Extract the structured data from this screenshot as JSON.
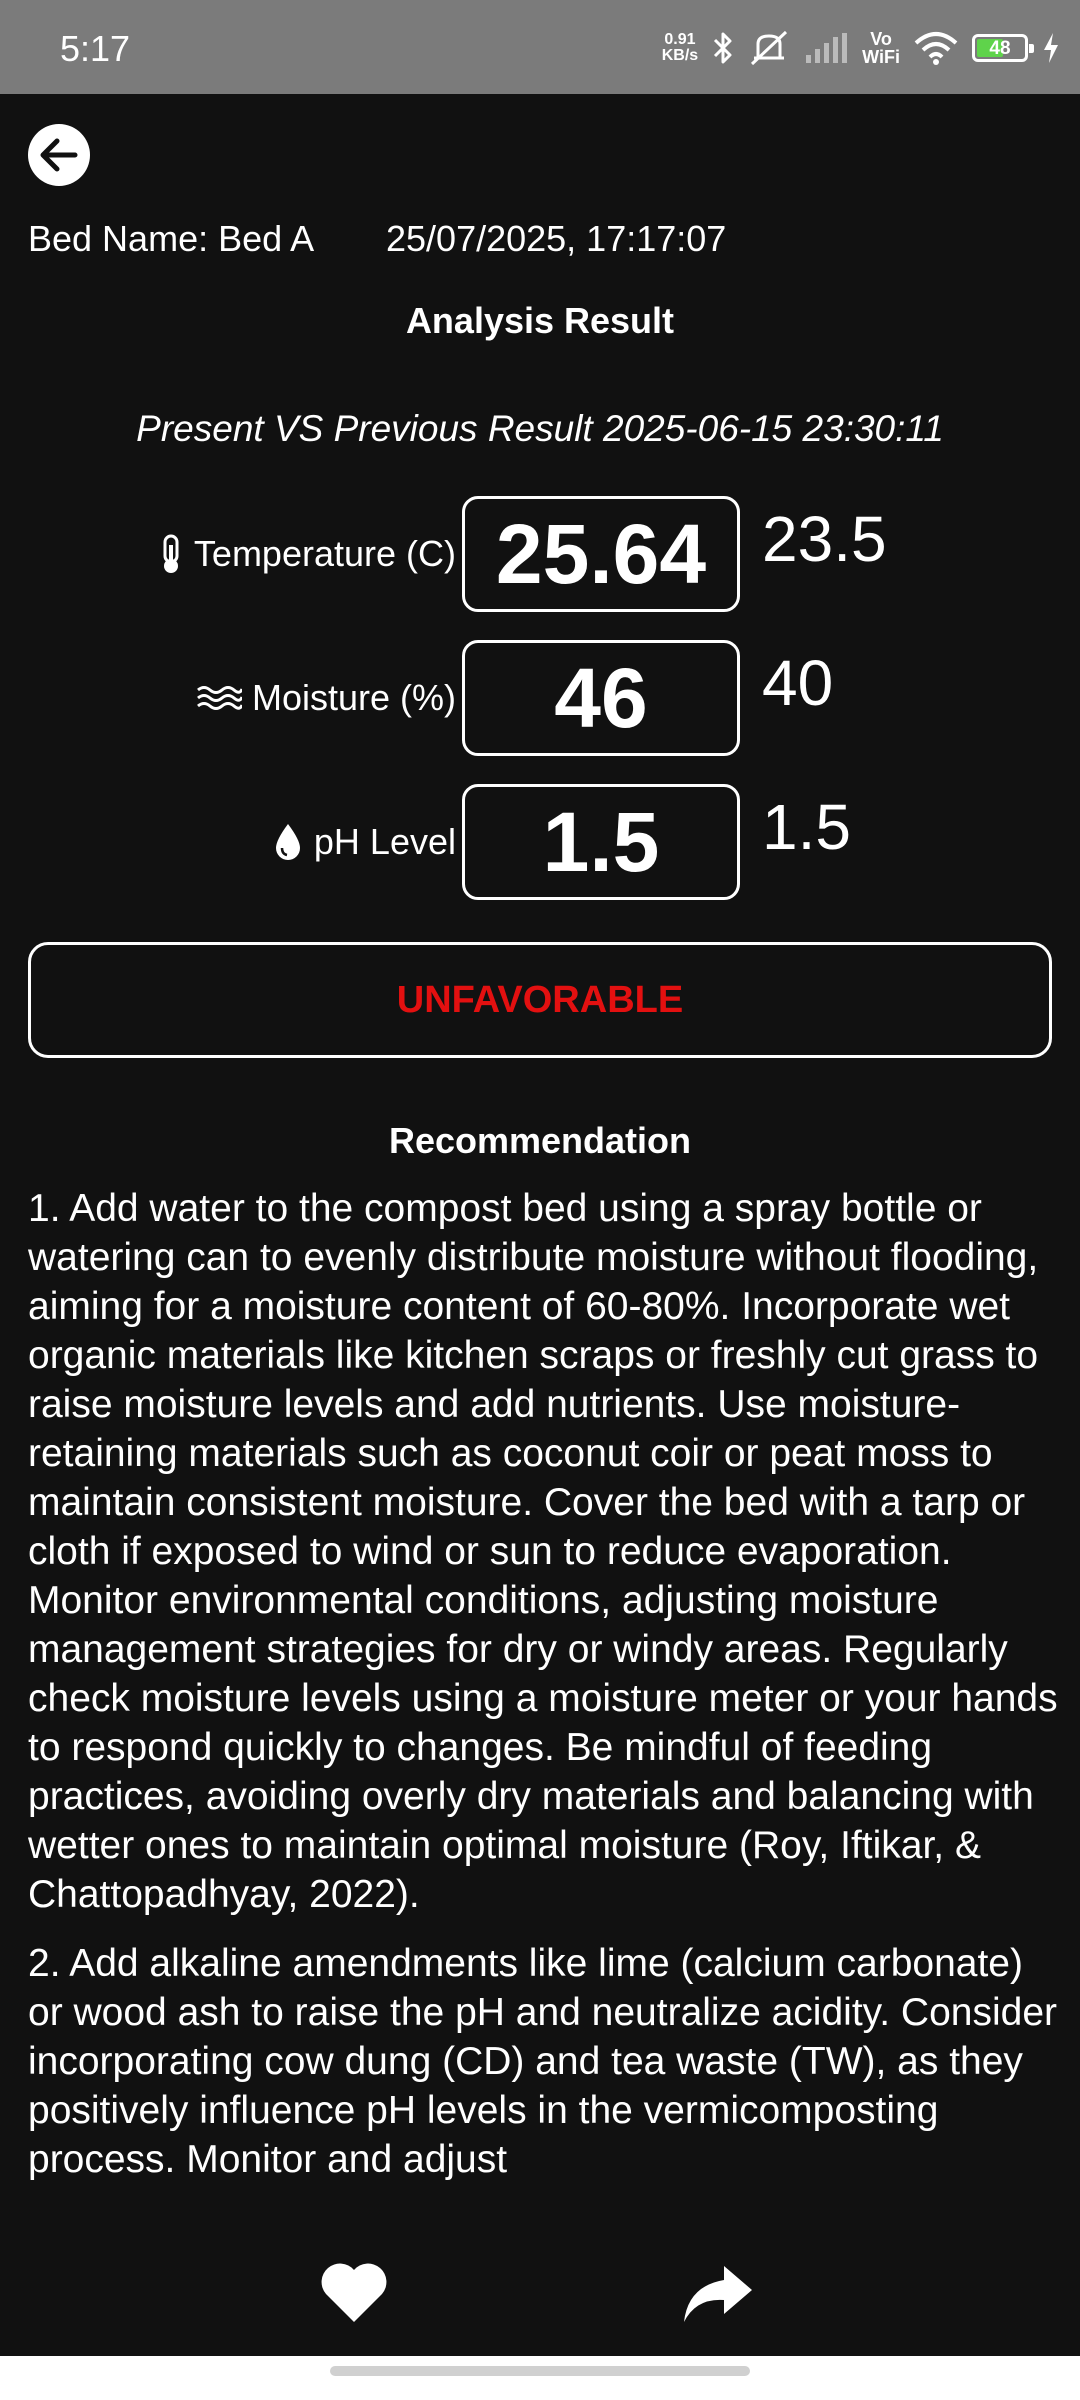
{
  "status_bar": {
    "time": "5:17",
    "net_speed_value": "0.91",
    "net_speed_unit": "KB/s",
    "vowifi_top": "Vo",
    "vowifi_bottom": "WiFi",
    "battery": "48",
    "icons": [
      "bluetooth-icon",
      "mute-icon",
      "signal-icon",
      "wifi-icon",
      "battery-icon",
      "charging-icon"
    ]
  },
  "header": {
    "bed_name": "Bed Name: Bed A",
    "datetime": "25/07/2025, 17:17:07",
    "title": "Analysis Result",
    "comparison": "Present VS Previous Result 2025-06-15 23:30:11"
  },
  "metrics": [
    {
      "icon": "thermometer-icon",
      "label": "Temperature (C)",
      "value": "25.64",
      "previous": "23.5"
    },
    {
      "icon": "waves-icon",
      "label": "Moisture (%)",
      "value": "46",
      "previous": "40"
    },
    {
      "icon": "droplet-icon",
      "label": "pH Level",
      "value": "1.5",
      "previous": "1.5"
    }
  ],
  "status": {
    "text": "UNFAVORABLE",
    "color": "#e31010"
  },
  "recommendation": {
    "title": "Recommendation",
    "items": [
      "1. Add water to the compost bed using a spray bottle or watering can to evenly distribute moisture without flooding, aiming for a moisture content of 60-80%. Incorporate wet organic materials like kitchen scraps or freshly cut grass to raise moisture levels and add nutrients. Use moisture-retaining materials such as coconut coir or peat moss to maintain consistent moisture. Cover the bed with a tarp or cloth if exposed to wind or sun to reduce evaporation. Monitor environmental conditions, adjusting moisture management strategies for dry or windy areas. Regularly check moisture levels using a moisture meter or your hands to respond quickly to changes. Be mindful of feeding practices, avoiding overly dry materials and balancing with wetter ones to maintain optimal moisture (Roy, Iftikar, & Chattopadhyay, 2022).",
      "2. Add alkaline amendments like lime (calcium carbonate) or wood ash to raise the pH and neutralize acidity. Consider incorporating cow dung (CD) and tea waste (TW), as they positively influence pH levels in the vermicomposting process. Monitor and adjust"
    ]
  },
  "bottom_actions": {
    "like_icon": "heart-icon",
    "share_icon": "share-icon"
  },
  "colors": {
    "background": "#111111",
    "status_bar": "#7b7b7b",
    "warning": "#e31010",
    "battery_fill": "#5fd34b"
  }
}
